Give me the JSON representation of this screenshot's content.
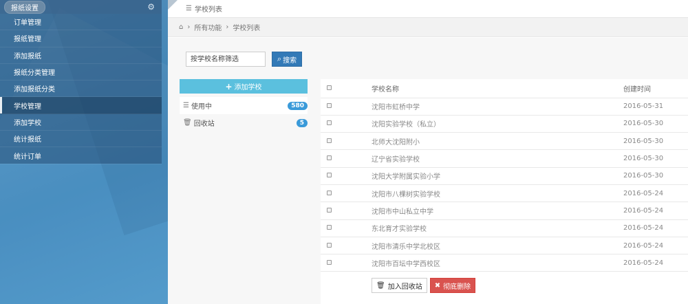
{
  "sidebar": {
    "header": "报纸设置",
    "items": [
      {
        "label": "订单管理"
      },
      {
        "label": "报纸管理"
      },
      {
        "label": "添加报纸"
      },
      {
        "label": "报纸分类管理"
      },
      {
        "label": "添加报纸分类"
      },
      {
        "label": "学校管理"
      },
      {
        "label": "添加学校"
      },
      {
        "label": "统计报纸"
      },
      {
        "label": "统计订单"
      }
    ],
    "active_index": 5
  },
  "topbar": {
    "title": "学校列表",
    "icon": "list-icon"
  },
  "breadcrumb": {
    "home_icon": "home-icon",
    "items": [
      "所有功能",
      "学校列表"
    ],
    "separator": "›"
  },
  "search": {
    "placeholder": "按学校名称筛选",
    "button_label": "搜索",
    "button_icon": "search-icon"
  },
  "left_panel": {
    "add_label": "添加学校",
    "in_use_label": "使用中",
    "in_use_count": "580",
    "recycle_label": "回收站",
    "recycle_count": "5"
  },
  "table": {
    "columns": [
      "",
      "学校名称",
      "创建时间"
    ],
    "rows": [
      {
        "name": "沈阳市虹桥中学",
        "date": "2016-05-31"
      },
      {
        "name": "沈阳实验学校（私立）",
        "date": "2016-05-30"
      },
      {
        "name": "北师大沈阳附小",
        "date": "2016-05-30"
      },
      {
        "name": "辽宁省实验学校",
        "date": "2016-05-30"
      },
      {
        "name": "沈阳大学附属实验小学",
        "date": "2016-05-30"
      },
      {
        "name": "沈阳市八棵树实验学校",
        "date": "2016-05-24"
      },
      {
        "name": "沈阳市中山私立中学",
        "date": "2016-05-24"
      },
      {
        "name": "东北育才实验学校",
        "date": "2016-05-24"
      },
      {
        "name": "沈阳市清乐中学北校区",
        "date": "2016-05-24"
      },
      {
        "name": "沈阳市百坛中学西校区",
        "date": "2016-05-24"
      }
    ]
  },
  "bulk_actions": {
    "recycle_label": "加入回收站",
    "delete_label": "彻底删除"
  },
  "colors": {
    "primary": "#337ab7",
    "info": "#5bc0de",
    "danger": "#d9534f",
    "badge": "#3a9ad9"
  }
}
